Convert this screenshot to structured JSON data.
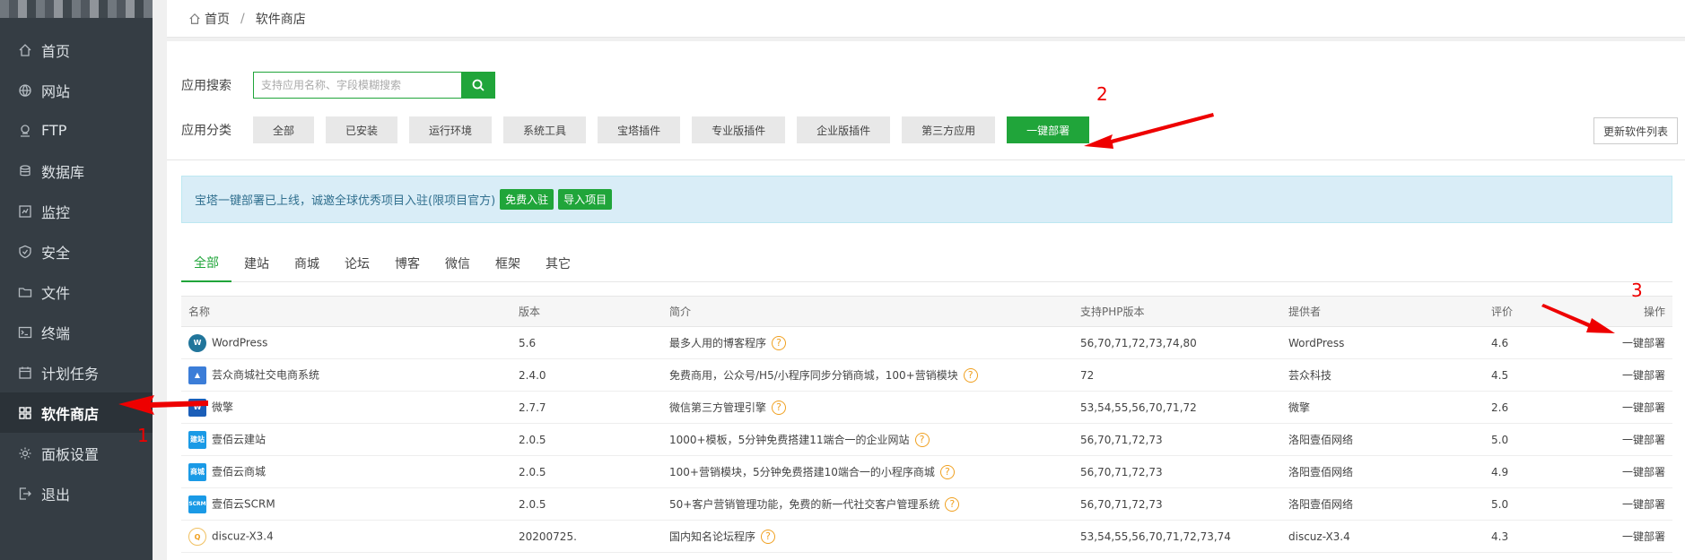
{
  "sidebar": {
    "items": [
      {
        "label": "首页",
        "icon": "home-icon"
      },
      {
        "label": "网站",
        "icon": "globe-icon"
      },
      {
        "label": "FTP",
        "icon": "ftp-icon"
      },
      {
        "label": "数据库",
        "icon": "database-icon"
      },
      {
        "label": "监控",
        "icon": "monitor-icon"
      },
      {
        "label": "安全",
        "icon": "shield-icon"
      },
      {
        "label": "文件",
        "icon": "folder-icon"
      },
      {
        "label": "终端",
        "icon": "terminal-icon"
      },
      {
        "label": "计划任务",
        "icon": "calendar-icon"
      },
      {
        "label": "软件商店",
        "icon": "apps-icon",
        "active": true
      },
      {
        "label": "面板设置",
        "icon": "gear-icon"
      },
      {
        "label": "退出",
        "icon": "logout-icon"
      }
    ]
  },
  "breadcrumb": {
    "home": "首页",
    "separator": "/",
    "current": "软件商店"
  },
  "search": {
    "label": "应用搜索",
    "placeholder": "支持应用名称、字段模糊搜索"
  },
  "categories": {
    "label": "应用分类",
    "items": [
      "全部",
      "已安装",
      "运行环境",
      "系统工具",
      "宝塔插件",
      "专业版插件",
      "企业版插件",
      "第三方应用",
      "一键部署"
    ],
    "active": "一键部署"
  },
  "refresh_label": "更新软件列表",
  "notice": {
    "text": "宝塔一键部署已上线，诚邀全球优秀项目入驻(限项目官方)",
    "btn1": "免费入驻",
    "btn2": "导入项目"
  },
  "tabs": [
    "全部",
    "建站",
    "商城",
    "论坛",
    "博客",
    "微信",
    "框架",
    "其它"
  ],
  "table": {
    "headers": {
      "name": "名称",
      "version": "版本",
      "desc": "简介",
      "php": "支持PHP版本",
      "provider": "提供者",
      "rating": "评价",
      "op": "操作"
    },
    "rows": [
      {
        "name": "WordPress",
        "version": "5.6",
        "desc": "最多人用的博客程序",
        "php": "56,70,71,72,73,74,80",
        "provider": "WordPress",
        "rating": "4.6",
        "op": "一键部署"
      },
      {
        "name": "芸众商城社交电商系统",
        "version": "2.4.0",
        "desc": "免费商用，公众号/H5/小程序同步分销商城，100+营销模块",
        "php": "72",
        "provider": "芸众科技",
        "rating": "4.5",
        "op": "一键部署"
      },
      {
        "name": "微擎",
        "version": "2.7.7",
        "desc": "微信第三方管理引擎",
        "php": "53,54,55,56,70,71,72",
        "provider": "微擎",
        "rating": "2.6",
        "op": "一键部署"
      },
      {
        "name": "壹佰云建站",
        "version": "2.0.5",
        "desc": "1000+模板，5分钟免费搭建11端合一的企业网站",
        "php": "56,70,71,72,73",
        "provider": "洛阳壹佰网络",
        "rating": "5.0",
        "op": "一键部署"
      },
      {
        "name": "壹佰云商城",
        "version": "2.0.5",
        "desc": "100+营销模块，5分钟免费搭建10端合一的小程序商城",
        "php": "56,70,71,72,73",
        "provider": "洛阳壹佰网络",
        "rating": "4.9",
        "op": "一键部署"
      },
      {
        "name": "壹佰云SCRM",
        "version": "2.0.5",
        "desc": "50+客户营销管理功能，免费的新一代社交客户管理系统",
        "php": "56,70,71,72,73",
        "provider": "洛阳壹佰网络",
        "rating": "5.0",
        "op": "一键部署"
      },
      {
        "name": "discuz-X3.4",
        "version": "20200725.",
        "desc": "国内知名论坛程序",
        "php": "53,54,55,56,70,71,72,73,74",
        "provider": "discuz-X3.4",
        "rating": "4.3",
        "op": "一键部署"
      }
    ]
  },
  "annotations": [
    "1",
    "2",
    "3"
  ],
  "colors": {
    "accent": "#20a53a",
    "sidebar": "#353d44",
    "annotation": "#e00000"
  }
}
